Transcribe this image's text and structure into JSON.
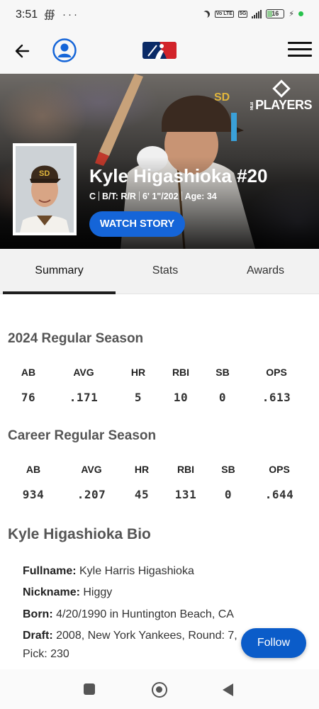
{
  "status_bar": {
    "time": "3:51",
    "left_icons": "∰ ···",
    "network": "5G",
    "volte": "Vo LTE",
    "battery": "16"
  },
  "header": {
    "back_icon": "arrow-left-icon",
    "profile_icon": "user-circle-icon",
    "logo": "mlb-logo",
    "menu_icon": "hamburger-menu-icon"
  },
  "hero": {
    "brand": "PLAYERS",
    "brand_small": "MLB",
    "name": "Kyle Higashioka #20",
    "meta": {
      "position": "C",
      "bats_throws": "B/T: R/R",
      "height_weight": "6' 1\"/202",
      "age": "Age: 34"
    },
    "watch_label": "WATCH STORY",
    "accent": "#1565d8"
  },
  "tabs": [
    {
      "label": "Summary",
      "active": true
    },
    {
      "label": "Stats",
      "active": false
    },
    {
      "label": "Awards",
      "active": false
    }
  ],
  "season": {
    "title": "2024 Regular Season",
    "headers": [
      "AB",
      "AVG",
      "HR",
      "RBI",
      "SB",
      "OPS"
    ],
    "values": [
      "76",
      ".171",
      "5",
      "10",
      "0",
      ".613"
    ]
  },
  "career": {
    "title": "Career Regular Season",
    "headers": [
      "AB",
      "AVG",
      "HR",
      "RBI",
      "SB",
      "OPS"
    ],
    "values": [
      "934",
      ".207",
      "45",
      "131",
      "0",
      ".644"
    ]
  },
  "bio": {
    "title": "Kyle Higashioka Bio",
    "lines": [
      {
        "label": "Fullname:",
        "value": " Kyle Harris Higashioka"
      },
      {
        "label": "Nickname:",
        "value": " Higgy"
      },
      {
        "label": "Born:",
        "value": " 4/20/1990 in Huntington Beach, CA"
      },
      {
        "label": "Draft:",
        "value": " 2008, New York Yankees, Round: 7,"
      },
      {
        "label": "",
        "value": "Pick: 230"
      }
    ]
  },
  "follow_label": "Follow",
  "follow_color": "#0b5cc9"
}
